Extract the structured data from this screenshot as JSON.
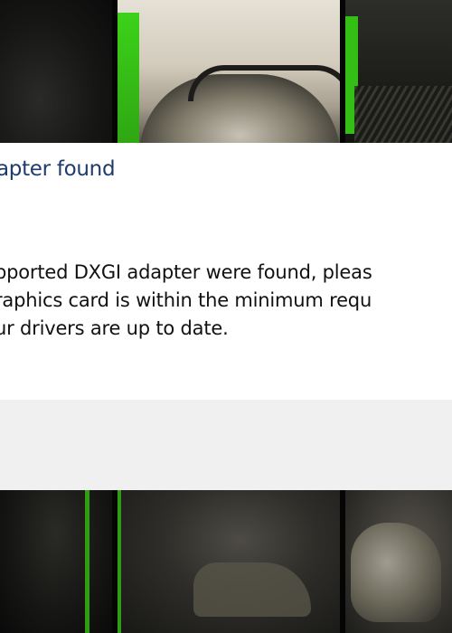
{
  "dialog": {
    "title": "apter found",
    "message_lines": [
      "pported DXGI adapter were found, pleas",
      "raphics card is within the minimum requ",
      "ur drivers are up to date."
    ]
  },
  "colors": {
    "title_text": "#1f3b6b",
    "body_text": "#111111",
    "dialog_background": "#ffffff",
    "footer_background": "#f0f0f0",
    "accent_green": "#34bf16"
  }
}
